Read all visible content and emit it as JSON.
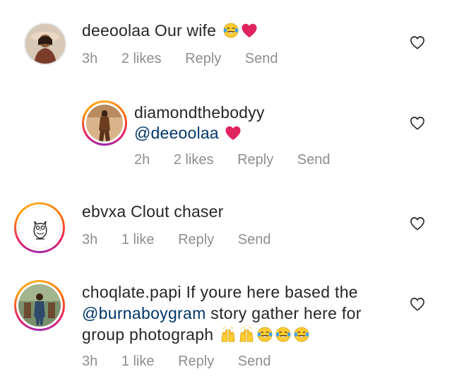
{
  "comments": [
    {
      "username": "deeoolaa",
      "text": "Our wife",
      "emojis": [
        "tears-of-joy",
        "red-heart"
      ],
      "time": "3h",
      "likes": "2 likes",
      "reply": "Reply",
      "send": "Send"
    },
    {
      "username": "diamondthebodyy",
      "mention": "@deeoolaa",
      "emojis": [
        "red-heart"
      ],
      "time": "2h",
      "likes": "2 likes",
      "reply": "Reply",
      "send": "Send"
    },
    {
      "username": "ebvxa",
      "text": "Clout chaser",
      "time": "3h",
      "likes": "1 like",
      "reply": "Reply",
      "send": "Send"
    },
    {
      "username": "choqlate.papi",
      "text_part1": "If youre here based the",
      "mention": "@burnaboygram",
      "text_part2": "story gather here for",
      "text_part3": "group photograph",
      "emojis": [
        "raising-hands",
        "raising-hands",
        "tears-of-joy",
        "tears-of-joy",
        "tears-of-joy"
      ],
      "time": "3h",
      "likes": "1 like",
      "reply": "Reply",
      "send": "Send"
    }
  ],
  "colors": {
    "text": "#262626",
    "meta": "#8e8e8e",
    "mention": "#00376b",
    "heart": "#e0245e",
    "emoji_yellow": "#ffcc33"
  }
}
